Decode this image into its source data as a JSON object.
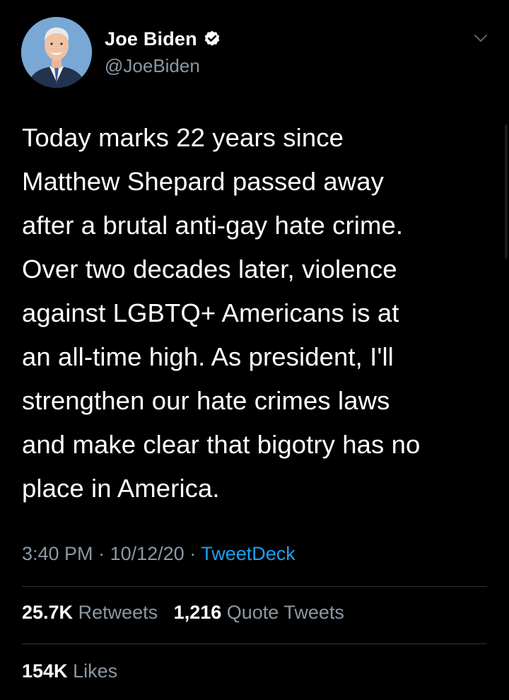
{
  "author": {
    "display_name": "Joe Biden",
    "handle": "@JoeBiden",
    "verified": true
  },
  "tweet": {
    "text": "Today marks 22 years since\nMatthew Shepard passed away\nafter a brutal anti-gay hate crime.\nOver two decades later, violence\nagainst LGBTQ+ Americans is at\nan all-time high. As president, I'll\nstrengthen our hate crimes laws\nand make clear that bigotry has no\nplace in America.",
    "time": "3:40 PM",
    "date": "10/12/20",
    "separator": "·",
    "source": "TweetDeck"
  },
  "stats": {
    "retweets_count": "25.7K",
    "retweets_label": "Retweets",
    "quote_tweets_count": "1,216",
    "quote_tweets_label": "Quote Tweets",
    "likes_count": "154K",
    "likes_label": "Likes"
  },
  "icons": {
    "verified": "verified-badge-icon",
    "menu": "chevron-down-icon"
  },
  "colors": {
    "background": "#000000",
    "text_primary": "#ffffff",
    "text_secondary": "#8b98a5",
    "link": "#1da1f2",
    "divider": "#2f3336"
  }
}
